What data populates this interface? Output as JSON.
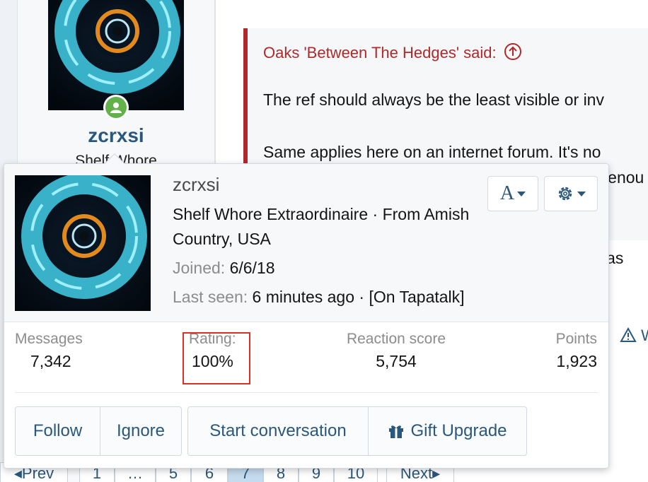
{
  "background": {
    "username": "zcrxsi",
    "user_title": "Shelf Whore",
    "quote_author": "Oaks 'Between The Hedges' said:",
    "quote_lines": [
      "The ref should always be the least visible or inv",
      "Same applies here on an internet forum. It's no",
      "e enou"
    ],
    "post_fragment": "e leas",
    "warn_fragment": "W",
    "pagination": {
      "prev": "Prev",
      "pages": [
        "1",
        "…",
        "5",
        "6",
        "7",
        "8",
        "9",
        "10"
      ],
      "next": "Next"
    }
  },
  "popup": {
    "username": "zcrxsi",
    "user_title": "Shelf Whore Extraordinaire · From Amish Country, USA",
    "joined_label": "Joined:",
    "joined_value": "6/6/18",
    "last_seen_label": "Last seen:",
    "last_seen_value": "6 minutes ago · [On Tapatalk]",
    "font_button": "A",
    "stats": [
      {
        "label": "Messages",
        "value": "7,342"
      },
      {
        "label": "Rating:",
        "value": "100%"
      },
      {
        "label": "Reaction score",
        "value": "5,754"
      },
      {
        "label": "Points",
        "value": "1,923"
      }
    ],
    "actions": {
      "follow": "Follow",
      "ignore": "Ignore",
      "start_conversation": "Start conversation",
      "gift_upgrade": "Gift Upgrade"
    }
  },
  "icons": {
    "online": "user-online-icon",
    "quote_jump": "arrow-up-circle-icon",
    "settings": "gear-icon",
    "gift": "gift-icon",
    "warning": "warning-triangle-icon"
  },
  "colors": {
    "link": "#2a577c",
    "quote_accent": "#b0282a",
    "online": "#63b14a",
    "highlight": "#d93125"
  }
}
